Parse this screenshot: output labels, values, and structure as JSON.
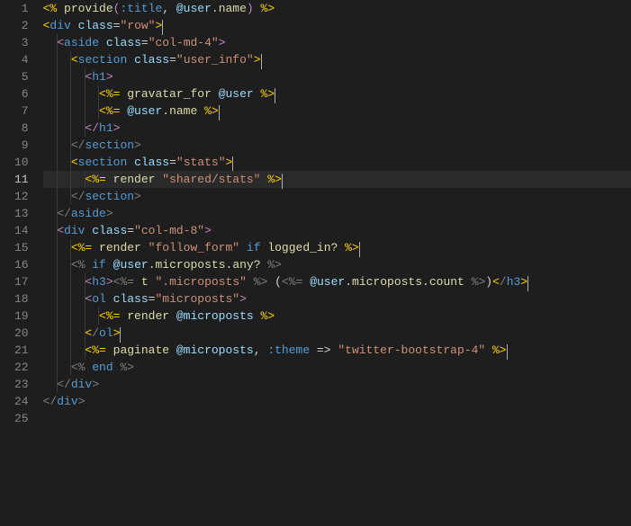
{
  "editor": {
    "active_line": 11,
    "cursor_line": 11,
    "lines": [
      {
        "n": 1,
        "indent": 0,
        "segs": [
          {
            "t": "<%",
            "c": "yel"
          },
          {
            "t": " ",
            "c": "txt"
          },
          {
            "t": "provide",
            "c": "func"
          },
          {
            "t": "(",
            "c": "pur"
          },
          {
            "t": ":title",
            "c": "sym"
          },
          {
            "t": ", ",
            "c": "txt"
          },
          {
            "t": "@user",
            "c": "var"
          },
          {
            "t": ".",
            "c": "txt"
          },
          {
            "t": "name",
            "c": "func"
          },
          {
            "t": ")",
            "c": "pur"
          },
          {
            "t": " ",
            "c": "txt"
          },
          {
            "t": "%>",
            "c": "yel"
          }
        ]
      },
      {
        "n": 2,
        "indent": 0,
        "segs": [
          {
            "t": "<",
            "c": "yel"
          },
          {
            "t": "div",
            "c": "kwtag"
          },
          {
            "t": " ",
            "c": "txt"
          },
          {
            "t": "class",
            "c": "attr"
          },
          {
            "t": "=",
            "c": "txt"
          },
          {
            "t": "\"row\"",
            "c": "str"
          },
          {
            "t": ">",
            "c": "yel"
          },
          {
            "caret": true
          }
        ]
      },
      {
        "n": 3,
        "indent": 1,
        "segs": [
          {
            "t": "<",
            "c": "pur"
          },
          {
            "t": "aside",
            "c": "kwtag"
          },
          {
            "t": " ",
            "c": "txt"
          },
          {
            "t": "class",
            "c": "attr"
          },
          {
            "t": "=",
            "c": "txt"
          },
          {
            "t": "\"col-md-4\"",
            "c": "str"
          },
          {
            "t": ">",
            "c": "pur"
          }
        ]
      },
      {
        "n": 4,
        "indent": 2,
        "segs": [
          {
            "t": "<",
            "c": "yel"
          },
          {
            "t": "section",
            "c": "kwtag"
          },
          {
            "t": " ",
            "c": "txt"
          },
          {
            "t": "class",
            "c": "attr"
          },
          {
            "t": "=",
            "c": "txt"
          },
          {
            "t": "\"user_info\"",
            "c": "str"
          },
          {
            "t": ">",
            "c": "yel"
          },
          {
            "caret": true
          }
        ]
      },
      {
        "n": 5,
        "indent": 3,
        "segs": [
          {
            "t": "<",
            "c": "pur"
          },
          {
            "t": "h1",
            "c": "kwtag"
          },
          {
            "t": ">",
            "c": "pur"
          }
        ]
      },
      {
        "n": 6,
        "indent": 4,
        "segs": [
          {
            "t": "<%=",
            "c": "yel"
          },
          {
            "t": " ",
            "c": "txt"
          },
          {
            "t": "gravatar_for",
            "c": "func"
          },
          {
            "t": " ",
            "c": "txt"
          },
          {
            "t": "@user",
            "c": "var"
          },
          {
            "t": " ",
            "c": "txt"
          },
          {
            "t": "%>",
            "c": "yel"
          },
          {
            "caret": true
          }
        ]
      },
      {
        "n": 7,
        "indent": 4,
        "segs": [
          {
            "t": "<%=",
            "c": "yel"
          },
          {
            "t": " ",
            "c": "txt"
          },
          {
            "t": "@user",
            "c": "var"
          },
          {
            "t": ".",
            "c": "txt"
          },
          {
            "t": "name",
            "c": "func"
          },
          {
            "t": " ",
            "c": "txt"
          },
          {
            "t": "%>",
            "c": "yel"
          },
          {
            "caret": true
          }
        ]
      },
      {
        "n": 8,
        "indent": 3,
        "segs": [
          {
            "t": "</",
            "c": "pur"
          },
          {
            "t": "h1",
            "c": "kwtag"
          },
          {
            "t": ">",
            "c": "pur"
          }
        ]
      },
      {
        "n": 9,
        "indent": 2,
        "segs": [
          {
            "t": "</",
            "c": "tagbr"
          },
          {
            "t": "section",
            "c": "kwtag"
          },
          {
            "t": ">",
            "c": "tagbr"
          }
        ]
      },
      {
        "n": 10,
        "indent": 2,
        "segs": [
          {
            "t": "<",
            "c": "yel"
          },
          {
            "t": "section",
            "c": "kwtag"
          },
          {
            "t": " ",
            "c": "txt"
          },
          {
            "t": "class",
            "c": "attr"
          },
          {
            "t": "=",
            "c": "txt"
          },
          {
            "t": "\"stats\"",
            "c": "str"
          },
          {
            "t": ">",
            "c": "yel"
          },
          {
            "caret": true
          }
        ]
      },
      {
        "n": 11,
        "indent": 3,
        "current": true,
        "segs": [
          {
            "t": "<%=",
            "c": "yel"
          },
          {
            "t": " ",
            "c": "txt"
          },
          {
            "t": "render",
            "c": "func"
          },
          {
            "t": " ",
            "c": "txt"
          },
          {
            "t": "\"shared/stats\"",
            "c": "str"
          },
          {
            "t": " ",
            "c": "txt"
          },
          {
            "t": "%>",
            "c": "yel"
          },
          {
            "caret": true
          }
        ]
      },
      {
        "n": 12,
        "indent": 2,
        "segs": [
          {
            "t": "</",
            "c": "tagbr"
          },
          {
            "t": "section",
            "c": "kwtag"
          },
          {
            "t": ">",
            "c": "tagbr"
          }
        ]
      },
      {
        "n": 13,
        "indent": 1,
        "segs": [
          {
            "t": "</",
            "c": "tagbr"
          },
          {
            "t": "aside",
            "c": "kwtag"
          },
          {
            "t": ">",
            "c": "tagbr"
          }
        ]
      },
      {
        "n": 14,
        "indent": 1,
        "segs": [
          {
            "t": "<",
            "c": "pur"
          },
          {
            "t": "div",
            "c": "kwtag"
          },
          {
            "t": " ",
            "c": "txt"
          },
          {
            "t": "class",
            "c": "attr"
          },
          {
            "t": "=",
            "c": "txt"
          },
          {
            "t": "\"col-md-8\"",
            "c": "str"
          },
          {
            "t": ">",
            "c": "pur"
          }
        ]
      },
      {
        "n": 15,
        "indent": 2,
        "segs": [
          {
            "t": "<%=",
            "c": "yel"
          },
          {
            "t": " ",
            "c": "txt"
          },
          {
            "t": "render",
            "c": "func"
          },
          {
            "t": " ",
            "c": "txt"
          },
          {
            "t": "\"follow_form\"",
            "c": "str"
          },
          {
            "t": " ",
            "c": "txt"
          },
          {
            "t": "if",
            "c": "kw"
          },
          {
            "t": " ",
            "c": "txt"
          },
          {
            "t": "logged_in?",
            "c": "func"
          },
          {
            "t": " ",
            "c": "txt"
          },
          {
            "t": "%>",
            "c": "yel"
          },
          {
            "caret": true
          }
        ]
      },
      {
        "n": 16,
        "indent": 2,
        "segs": [
          {
            "t": "<%",
            "c": "tagbr"
          },
          {
            "t": " ",
            "c": "txt"
          },
          {
            "t": "if",
            "c": "kw"
          },
          {
            "t": " ",
            "c": "txt"
          },
          {
            "t": "@user",
            "c": "var"
          },
          {
            "t": ".",
            "c": "txt"
          },
          {
            "t": "microposts",
            "c": "func"
          },
          {
            "t": ".",
            "c": "txt"
          },
          {
            "t": "any?",
            "c": "func"
          },
          {
            "t": " ",
            "c": "txt"
          },
          {
            "t": "%>",
            "c": "tagbr"
          }
        ]
      },
      {
        "n": 17,
        "indent": 3,
        "segs": [
          {
            "t": "<",
            "c": "pur"
          },
          {
            "t": "h3",
            "c": "kwtag"
          },
          {
            "t": ">",
            "c": "pur"
          },
          {
            "t": "<%=",
            "c": "tagbr"
          },
          {
            "t": " ",
            "c": "txt"
          },
          {
            "t": "t",
            "c": "func"
          },
          {
            "t": " ",
            "c": "txt"
          },
          {
            "t": "\".microposts\"",
            "c": "str"
          },
          {
            "t": " ",
            "c": "txt"
          },
          {
            "t": "%>",
            "c": "tagbr"
          },
          {
            "t": " ",
            "c": "txt"
          },
          {
            "t": "(",
            "c": "txt"
          },
          {
            "t": "<%=",
            "c": "tagbr"
          },
          {
            "t": " ",
            "c": "txt"
          },
          {
            "t": "@user",
            "c": "var"
          },
          {
            "t": ".",
            "c": "txt"
          },
          {
            "t": "microposts",
            "c": "func"
          },
          {
            "t": ".",
            "c": "txt"
          },
          {
            "t": "count",
            "c": "func"
          },
          {
            "t": " ",
            "c": "txt"
          },
          {
            "t": "%>",
            "c": "tagbr"
          },
          {
            "t": ")",
            "c": "txt"
          },
          {
            "t": "<",
            "c": "yel"
          },
          {
            "t": "/",
            "c": "tagbr"
          },
          {
            "t": "h3",
            "c": "kwtag"
          },
          {
            "t": ">",
            "c": "yel"
          },
          {
            "caret": true
          }
        ]
      },
      {
        "n": 18,
        "indent": 3,
        "segs": [
          {
            "t": "<",
            "c": "pur"
          },
          {
            "t": "ol",
            "c": "kwtag"
          },
          {
            "t": " ",
            "c": "txt"
          },
          {
            "t": "class",
            "c": "attr"
          },
          {
            "t": "=",
            "c": "txt"
          },
          {
            "t": "\"microposts\"",
            "c": "str"
          },
          {
            "t": ">",
            "c": "pur"
          }
        ]
      },
      {
        "n": 19,
        "indent": 4,
        "segs": [
          {
            "t": "<%=",
            "c": "yel"
          },
          {
            "t": " ",
            "c": "txt"
          },
          {
            "t": "render",
            "c": "func"
          },
          {
            "t": " ",
            "c": "txt"
          },
          {
            "t": "@microposts",
            "c": "var"
          },
          {
            "t": " ",
            "c": "txt"
          },
          {
            "t": "%>",
            "c": "yel"
          }
        ]
      },
      {
        "n": 20,
        "indent": 3,
        "segs": [
          {
            "t": "<",
            "c": "yel"
          },
          {
            "t": "/",
            "c": "tagbr"
          },
          {
            "t": "ol",
            "c": "kwtag"
          },
          {
            "t": ">",
            "c": "yel"
          },
          {
            "caret": true
          }
        ]
      },
      {
        "n": 21,
        "indent": 3,
        "segs": [
          {
            "t": "<%=",
            "c": "yel"
          },
          {
            "t": " ",
            "c": "txt"
          },
          {
            "t": "paginate",
            "c": "func"
          },
          {
            "t": " ",
            "c": "txt"
          },
          {
            "t": "@microposts",
            "c": "var"
          },
          {
            "t": ", ",
            "c": "txt"
          },
          {
            "t": ":theme",
            "c": "sym"
          },
          {
            "t": " => ",
            "c": "txt"
          },
          {
            "t": "\"twitter-bootstrap-4\"",
            "c": "str"
          },
          {
            "t": " ",
            "c": "txt"
          },
          {
            "t": "%>",
            "c": "yel"
          },
          {
            "caret": true
          }
        ]
      },
      {
        "n": 22,
        "indent": 2,
        "segs": [
          {
            "t": "<%",
            "c": "tagbr"
          },
          {
            "t": " ",
            "c": "txt"
          },
          {
            "t": "end",
            "c": "kw"
          },
          {
            "t": " ",
            "c": "txt"
          },
          {
            "t": "%>",
            "c": "tagbr"
          }
        ]
      },
      {
        "n": 23,
        "indent": 1,
        "segs": [
          {
            "t": "</",
            "c": "tagbr"
          },
          {
            "t": "div",
            "c": "kwtag"
          },
          {
            "t": ">",
            "c": "tagbr"
          }
        ]
      },
      {
        "n": 24,
        "indent": 0,
        "segs": [
          {
            "t": "</",
            "c": "tagbr"
          },
          {
            "t": "div",
            "c": "kwtag"
          },
          {
            "t": ">",
            "c": "tagbr"
          }
        ]
      },
      {
        "n": 25,
        "indent": 0,
        "segs": []
      }
    ],
    "indent_guide_levels": 5,
    "indent_width": 2
  }
}
